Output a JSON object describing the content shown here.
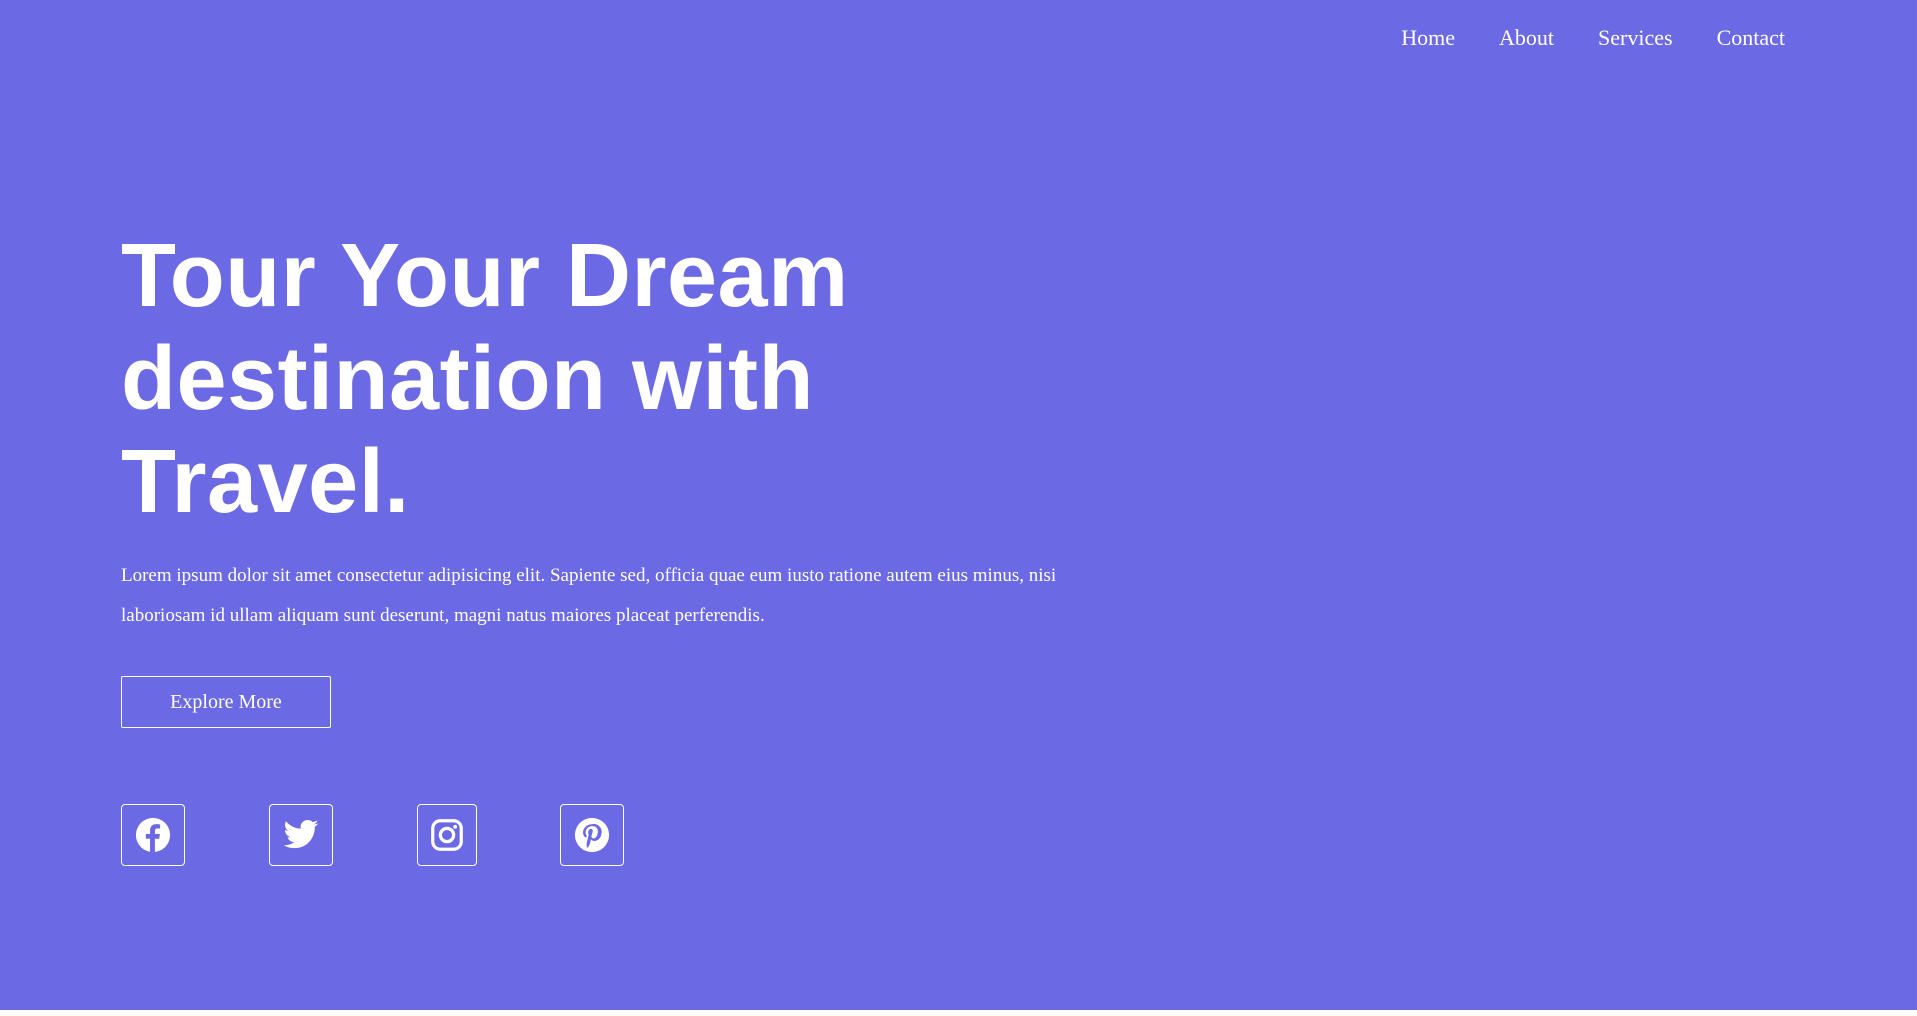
{
  "nav": {
    "items": [
      {
        "label": "Home"
      },
      {
        "label": "About"
      },
      {
        "label": "Services"
      },
      {
        "label": "Contact"
      }
    ]
  },
  "hero": {
    "title": "Tour Your Dream destination with Travel.",
    "text": "Lorem ipsum dolor sit amet consectetur adipisicing elit. Sapiente sed, officia quae eum iusto ratione autem eius minus, nisi laboriosam id ullam aliquam sunt deserunt, magni natus maiores placeat perferendis.",
    "cta_label": "Explore More"
  },
  "socials": [
    {
      "icon": "facebook-icon"
    },
    {
      "icon": "twitter-icon"
    },
    {
      "icon": "instagram-icon"
    },
    {
      "icon": "pinterest-icon"
    }
  ],
  "colors": {
    "background": "#6c69e4",
    "foreground": "#ffffff"
  }
}
